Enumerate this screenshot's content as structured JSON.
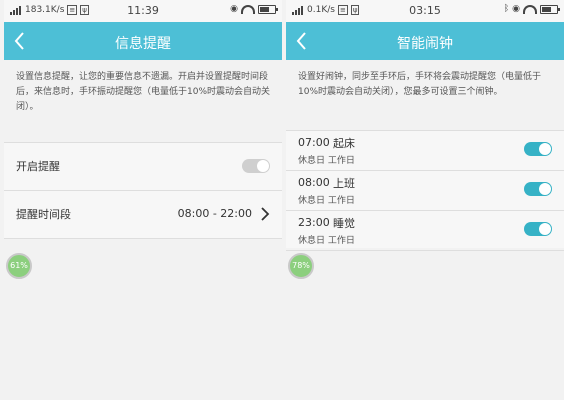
{
  "left": {
    "status": {
      "speed": "183.1K/s",
      "time": "11:39"
    },
    "title": "信息提醒",
    "description": "设置信息提醒，让您的重要信息不遗漏。开启并设置提醒时间段后，来信息时，手环振动提醒您（电量低于10%时震动会自动关闭）。",
    "enable_label": "开启提醒",
    "enable_on": false,
    "period_label": "提醒时间段",
    "period_value": "08:00 - 22:00",
    "badge": "61%"
  },
  "right": {
    "status": {
      "speed": "0.1K/s",
      "time": "03:15"
    },
    "title": "智能闹钟",
    "description": "设置好闹钟，同步至手环后，手环将会震动提醒您（电量低于10%时震动会自动关闭），您最多可设置三个闹钟。",
    "alarms": [
      {
        "time": "07:00",
        "name": "起床",
        "days": "休息日 工作日",
        "on": true
      },
      {
        "time": "08:00",
        "name": "上班",
        "days": "休息日 工作日",
        "on": true
      },
      {
        "time": "23:00",
        "name": "睡觉",
        "days": "休息日 工作日",
        "on": true
      }
    ],
    "badge": "78%"
  },
  "colors": {
    "accent": "#4dbfd6",
    "toggle_on": "#36b2c6",
    "badge": "#8ccf7e"
  }
}
